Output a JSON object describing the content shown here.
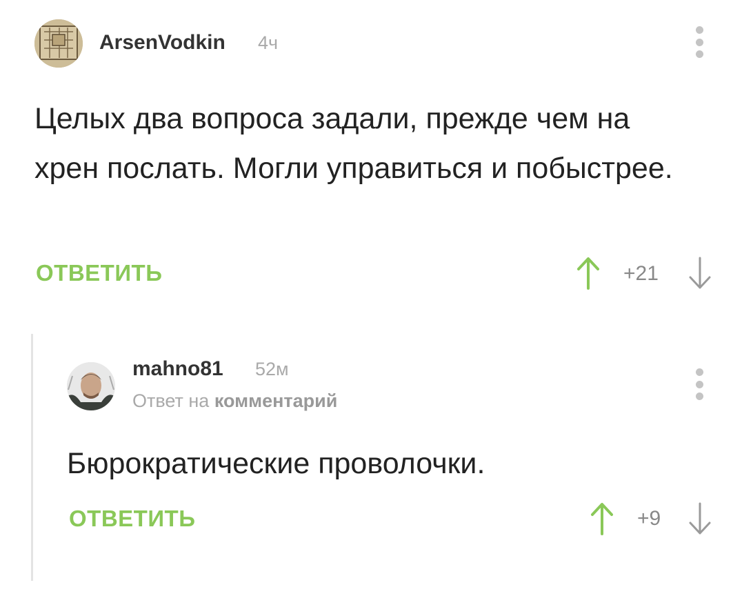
{
  "comments": [
    {
      "author": "ArsenVodkin",
      "time": "4ч",
      "text": "Целых два вопроса задали, прежде чем на хрен послать. Могли управиться и побыстрее.",
      "reply_label": "ОТВЕТИТЬ",
      "rating": "+21"
    },
    {
      "author": "mahno81",
      "time": "52м",
      "reply_to_prefix": "Ответ на",
      "reply_to_link": "комментарий",
      "text": "Бюрократические проволочки.",
      "reply_label": "ОТВЕТИТЬ",
      "rating": "+9"
    }
  ],
  "colors": {
    "accent_green": "#8ac858",
    "muted_gray": "#a9a9a9"
  },
  "icons": {
    "more": "more-vertical-icon",
    "upvote": "arrow-up-icon",
    "downvote": "arrow-down-icon"
  }
}
